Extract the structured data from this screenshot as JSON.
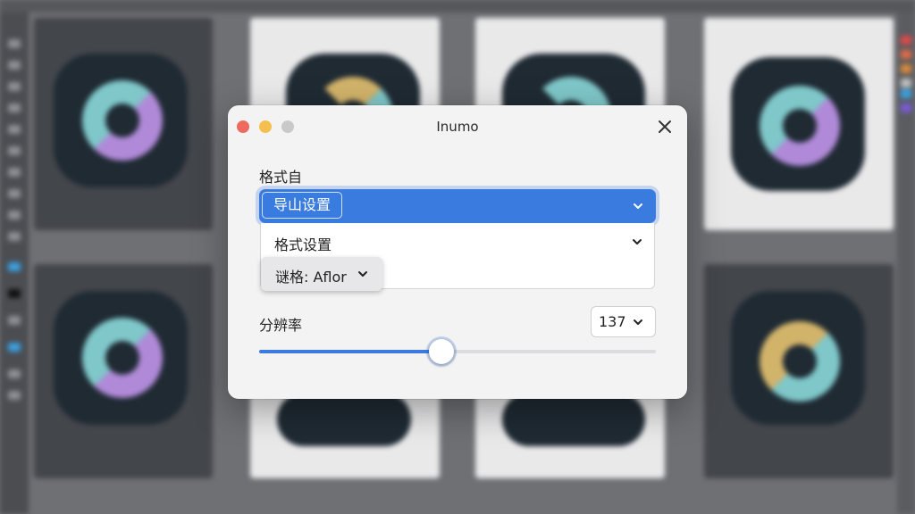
{
  "dialog": {
    "title": "Inumo",
    "format_label": "格式自",
    "export_select": {
      "selected": "导山设置"
    },
    "menu_item": "格式设置",
    "popover_label": "谜格: Aflor",
    "resolution_label": "分辨率",
    "resolution_value": "137",
    "slider": {
      "value_fraction": 0.46
    }
  },
  "colors": {
    "accent": "#3a7be0",
    "traffic_red": "#ee6a5f",
    "traffic_yellow": "#f5bf4f",
    "traffic_gray": "#c9c9cc"
  },
  "icons": [
    "close-icon",
    "chevron-down-icon"
  ]
}
